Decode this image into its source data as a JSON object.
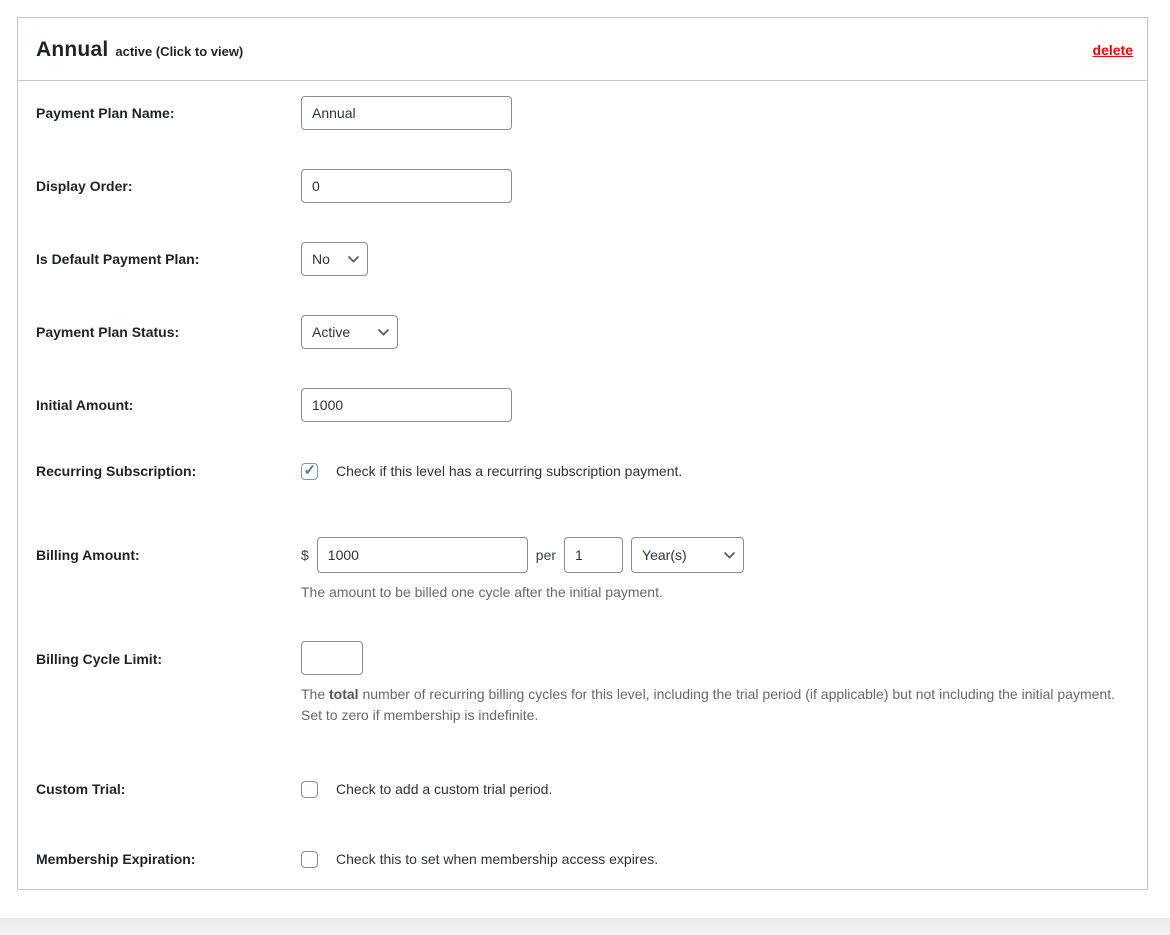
{
  "header": {
    "title": "Annual",
    "status_note": "active (Click to view)",
    "delete_label": "delete"
  },
  "colors": {
    "accent_blue": "#3582c4",
    "delete_red": "#ff0000",
    "label_dark": "#1d2327",
    "helper_gray": "#646970",
    "input_border_gray": "#8c8c8c",
    "card_border_gray": "#c3c4c7"
  },
  "icons": {
    "chevron_down": "chevron-down-icon",
    "checkmark": "checkmark-icon"
  },
  "fields": {
    "payment_plan_name": {
      "label": "Payment Plan Name:",
      "value": "Annual"
    },
    "display_order": {
      "label": "Display Order:",
      "value": "0"
    },
    "is_default": {
      "label": "Is Default Payment Plan:",
      "selected": "No"
    },
    "plan_status": {
      "label": "Payment Plan Status:",
      "selected": "Active"
    },
    "initial_amount": {
      "label": "Initial Amount:",
      "value": "1000"
    },
    "recurring": {
      "label": "Recurring Subscription:",
      "checked_attr": "checked",
      "description": "Check if this level has a recurring subscription payment."
    },
    "billing_amount": {
      "label": "Billing Amount:",
      "currency": "$",
      "value": "1000",
      "per_label": "per",
      "cycle_value": "1",
      "period_selected": "Year(s)",
      "help": "The amount to be billed one cycle after the initial payment."
    },
    "billing_cycle_limit": {
      "label": "Billing Cycle Limit:",
      "value": "",
      "help_pre": "The ",
      "help_bold": "total",
      "help_post": " number of recurring billing cycles for this level, including the trial period (if applicable) but not including the initial payment. Set to zero if membership is indefinite."
    },
    "custom_trial": {
      "label": "Custom Trial:",
      "description": "Check to add a custom trial period."
    },
    "membership_expiration": {
      "label": "Membership Expiration:",
      "description": "Check this to set when membership access expires."
    }
  }
}
